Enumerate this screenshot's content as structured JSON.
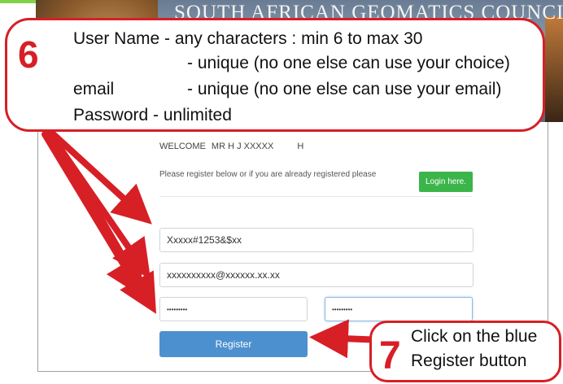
{
  "banner": {
    "title": "SOUTH AFRICAN GEOMATICS COUNCIL"
  },
  "form": {
    "welcome_prefix": "WELCOME",
    "welcome_name": "MR H J XXXXX",
    "welcome_initial": "H",
    "instruction": "Please register below or if you are already registered please",
    "login_label": "Login here.",
    "username_value": "Xxxxx#1253&$xx",
    "email_value": "xxxxxxxxxx@xxxxxx.xx.xx",
    "password_value": "•••••••••",
    "confirm_password_value": "•••••••••",
    "register_label": "Register"
  },
  "callout6": {
    "number": "6",
    "line1": "User Name - any characters : min 6 to max 30",
    "line2": "- unique (no one else can use your choice)",
    "line3_label": "email",
    "line3_text": "- unique (no one else can use your email)",
    "line4": "Password  - unlimited"
  },
  "callout7": {
    "number": "7",
    "line1": "Click on the blue",
    "line2": "Register button"
  },
  "colors": {
    "accent_red": "#d71f26",
    "register_blue": "#4d90cf",
    "login_green": "#3bb54a"
  }
}
